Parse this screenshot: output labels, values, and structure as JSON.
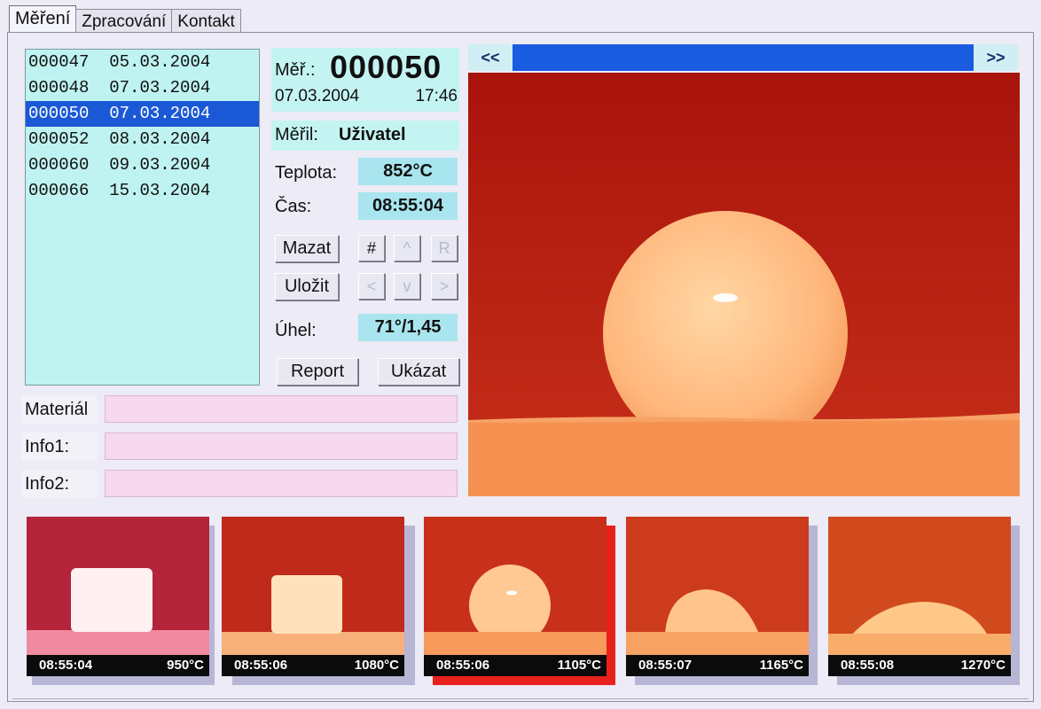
{
  "tabs": [
    "Měření",
    "Zpracování",
    "Kontakt"
  ],
  "measurements": [
    {
      "id": "000047",
      "date": "05.03.2004"
    },
    {
      "id": "000048",
      "date": "07.03.2004"
    },
    {
      "id": "000050",
      "date": "07.03.2004"
    },
    {
      "id": "000052",
      "date": "08.03.2004"
    },
    {
      "id": "000060",
      "date": "09.03.2004"
    },
    {
      "id": "000066",
      "date": "15.03.2004"
    }
  ],
  "selected_index": 2,
  "detail": {
    "mer_label": "Měř.:",
    "mer_number": "000050",
    "date": "07.03.2004",
    "time": "17:46",
    "meril_label": "Měřil:",
    "meril_value": "Uživatel",
    "teplota_label": "Teplota:",
    "teplota_value": "852°C",
    "cas_label": "Čas:",
    "cas_value": "08:55:04",
    "uhel_label": "Úhel:",
    "uhel_value": "71°/1,45"
  },
  "buttons": {
    "mazat": "Mazat",
    "ulozit": "Uložit",
    "hash": "#",
    "up": "^",
    "r": "R",
    "left": "<",
    "down": "v",
    "right": ">",
    "report": "Report",
    "ukazat": "Ukázat"
  },
  "fields": {
    "material_label": "Materiál",
    "info1_label": "Info1:",
    "info2_label": "Info2:",
    "material_value": "",
    "info1_value": "",
    "info2_value": ""
  },
  "navigator": {
    "prev": "<<",
    "next": ">>"
  },
  "thumbnails": [
    {
      "time": "08:55:04",
      "temp": "950°C"
    },
    {
      "time": "08:55:06",
      "temp": "1080°C"
    },
    {
      "time": "08:55:06",
      "temp": "1105°C"
    },
    {
      "time": "08:55:07",
      "temp": "1165°C"
    },
    {
      "time": "08:55:08",
      "temp": "1270°C"
    }
  ],
  "colors": {
    "accent_blue": "#1a5ce0",
    "list_bg": "#bff3f1",
    "field_bg": "#f6d8ef",
    "image_red": "#b3170f",
    "image_base": "#f08a4c"
  }
}
